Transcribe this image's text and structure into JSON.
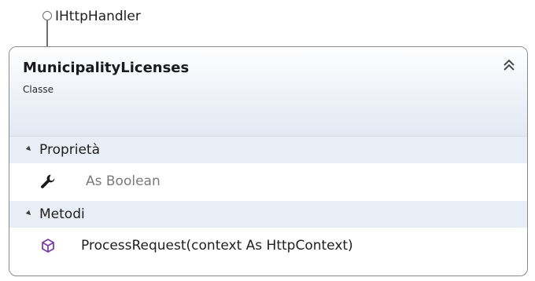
{
  "interface": {
    "name": "IHttpHandler"
  },
  "class": {
    "name": "MunicipalityLicenses",
    "stereotype": "Classe",
    "collapse_icon": "double-chevron-up-icon"
  },
  "compartments": {
    "properties": {
      "label": "Proprietà",
      "items": [
        {
          "text": "As Boolean",
          "icon": "wrench-icon"
        }
      ]
    },
    "methods": {
      "label": "Metodi",
      "items": [
        {
          "text": "ProcessRequest(context As HttpContext)",
          "icon": "method-cube-icon"
        }
      ]
    }
  },
  "colors": {
    "method_icon": "#7b3fa6",
    "property_icon": "#1a1a1a",
    "header_gradient_end": "#e3e8f3",
    "compartment_header": "#e9edf5",
    "border": "#8a8a8a"
  }
}
